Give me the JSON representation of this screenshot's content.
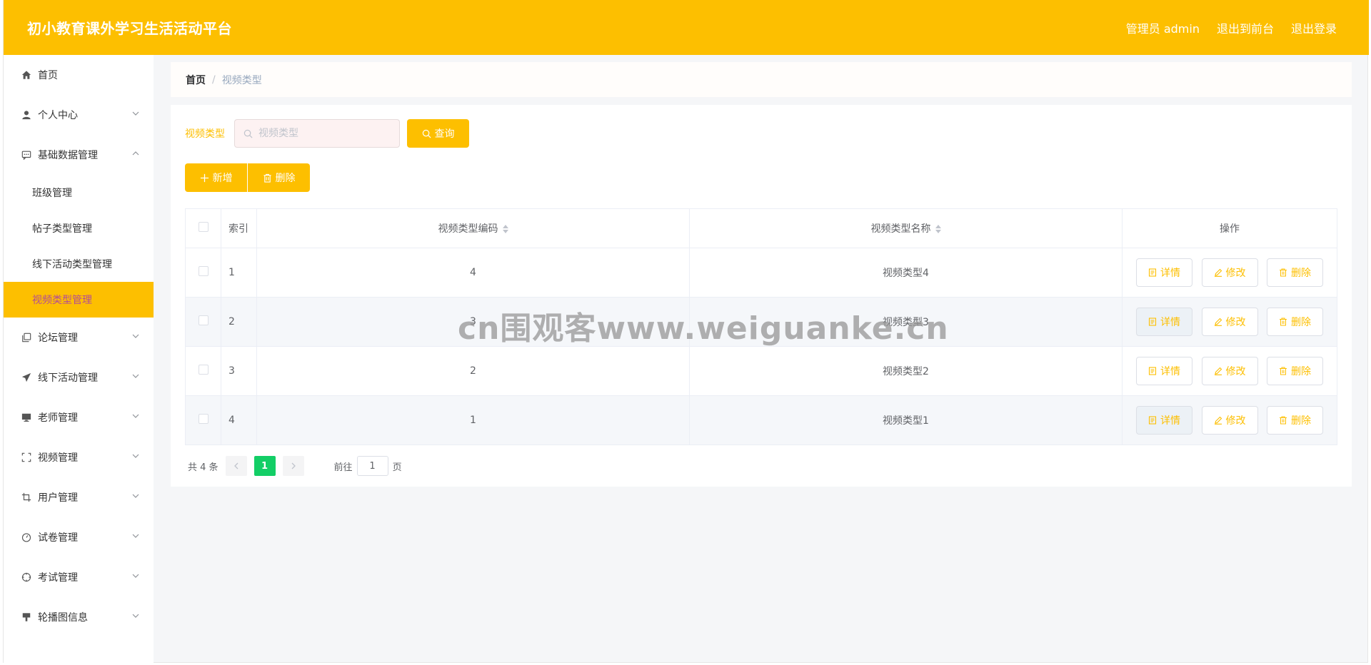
{
  "header": {
    "title": "初小教育课外学习生活活动平台",
    "user": "管理员 admin",
    "to_front": "退出到前台",
    "logout": "退出登录"
  },
  "sidebar": {
    "items": [
      {
        "label": "首页",
        "icon": "home-icon"
      },
      {
        "label": "个人中心",
        "icon": "user-icon"
      },
      {
        "label": "基础数据管理",
        "icon": "chat-icon"
      },
      {
        "label": "论坛管理",
        "icon": "copy-icon"
      },
      {
        "label": "线下活动管理",
        "icon": "send-icon"
      },
      {
        "label": "老师管理",
        "icon": "monitor-icon"
      },
      {
        "label": "视频管理",
        "icon": "fullscreen-icon"
      },
      {
        "label": "用户管理",
        "icon": "crop-icon"
      },
      {
        "label": "试卷管理",
        "icon": "stopwatch-icon"
      },
      {
        "label": "考试管理",
        "icon": "aim-icon"
      },
      {
        "label": "轮播图信息",
        "icon": "brush-icon"
      }
    ],
    "sub_items": [
      "班级管理",
      "帖子类型管理",
      "线下活动类型管理",
      "视频类型管理"
    ]
  },
  "breadcrumb": {
    "home": "首页",
    "sep": "/",
    "current": "视频类型"
  },
  "search": {
    "label": "视频类型",
    "placeholder": "视频类型",
    "button": "查询"
  },
  "actions": {
    "add": "新增",
    "delete": "删除"
  },
  "table": {
    "columns": [
      "索引",
      "视频类型编码",
      "视频类型名称",
      "操作"
    ],
    "rows": [
      {
        "index": "1",
        "code": "4",
        "name": "视频类型4"
      },
      {
        "index": "2",
        "code": "3",
        "name": "视频类型3"
      },
      {
        "index": "3",
        "code": "2",
        "name": "视频类型2"
      },
      {
        "index": "4",
        "code": "1",
        "name": "视频类型1"
      }
    ],
    "row_actions": {
      "detail": "详情",
      "edit": "修改",
      "delete": "删除"
    }
  },
  "pagination": {
    "total": "共 4 条",
    "current": "1",
    "goto_label": "前往",
    "goto_value": "1",
    "page_unit": "页"
  },
  "watermark": "cn围观客www.weiguanke.cn",
  "colors": {
    "accent": "#fdbf00",
    "active_text": "#b34c97",
    "page_active": "#13ce66"
  }
}
